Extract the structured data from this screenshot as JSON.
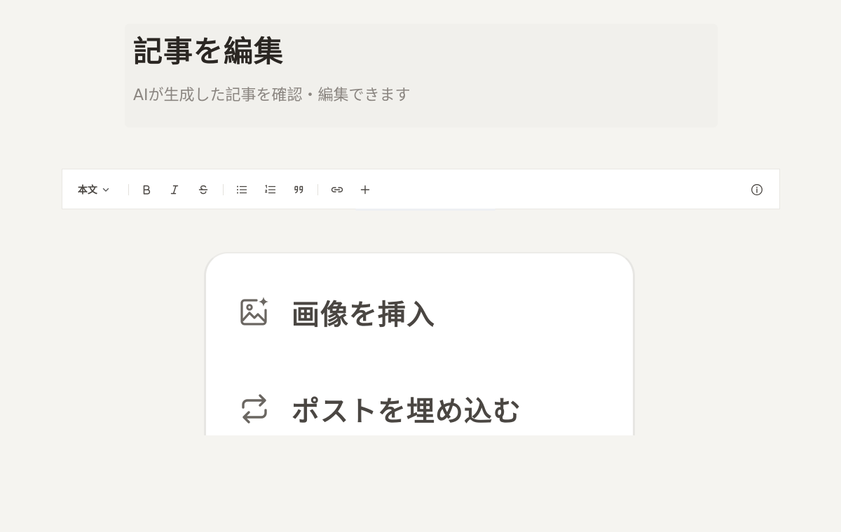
{
  "header": {
    "title": "記事を編集",
    "subtitle": "AIが生成した記事を確認・編集できます"
  },
  "toolbar": {
    "style_select": {
      "value": "本文"
    },
    "buttons": [
      {
        "icon": "bold-icon"
      },
      {
        "icon": "italic-icon"
      },
      {
        "icon": "strikethrough-icon"
      },
      {
        "icon": "bullet-list-icon"
      },
      {
        "icon": "numbered-list-icon"
      },
      {
        "icon": "quote-icon"
      },
      {
        "icon": "link-icon"
      },
      {
        "icon": "plus-icon"
      },
      {
        "icon": "info-icon"
      }
    ]
  },
  "insert_menu": {
    "items": [
      {
        "icon": "image-add-icon",
        "label": "画像を挿入"
      },
      {
        "icon": "repost-icon",
        "label": "ポストを埋め込む"
      }
    ]
  },
  "colors": {
    "background": "#f5f4f0",
    "header_card": "#f1f0ec",
    "title": "#2b2723",
    "subtitle": "#8a8580",
    "toolbar_bg": "#ffffff",
    "menu_text": "#4a4642"
  }
}
